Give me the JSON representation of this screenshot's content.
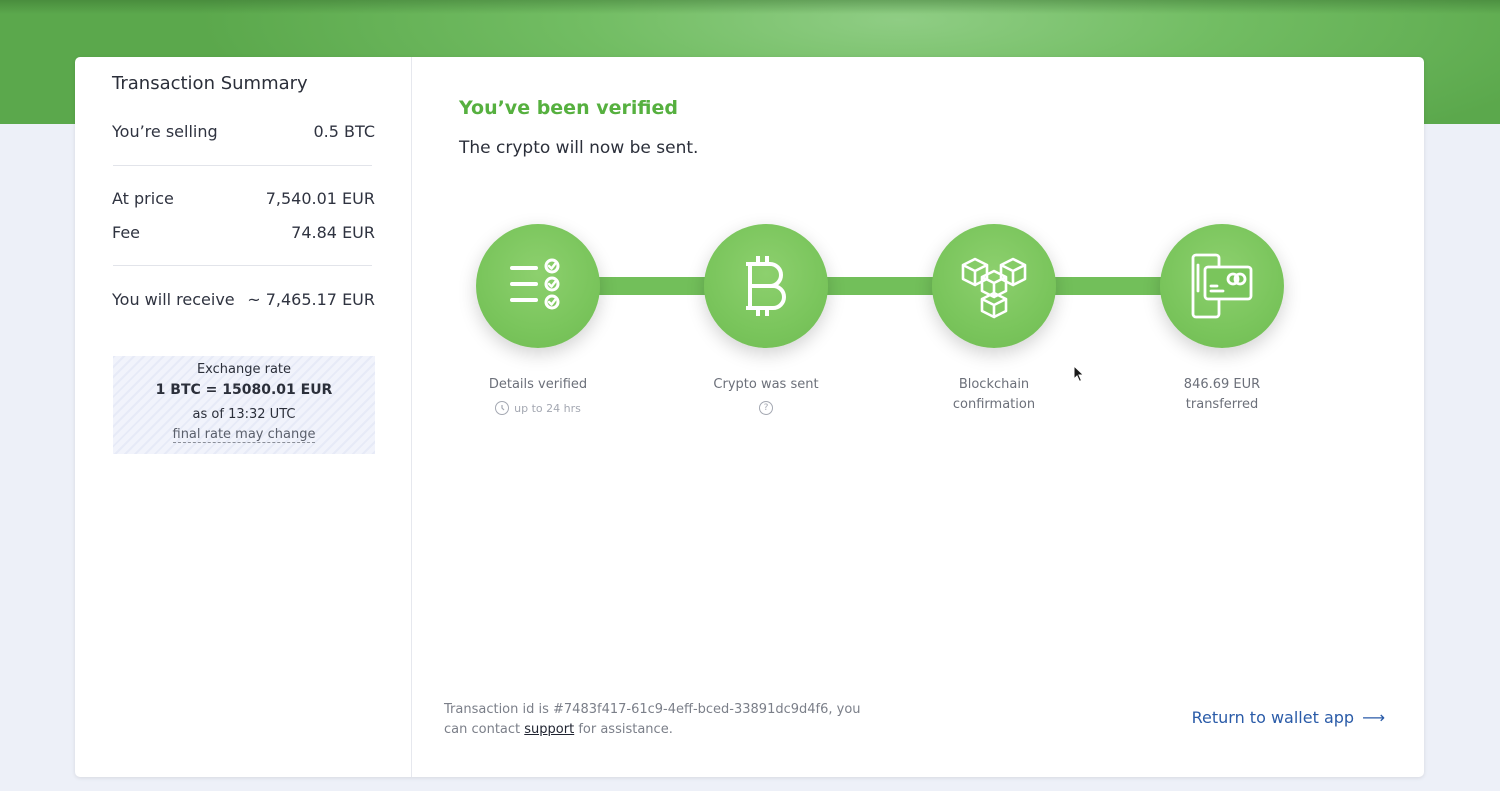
{
  "summary": {
    "title": "Transaction Summary",
    "selling_label": "You’re selling",
    "selling_value": "0.5 BTC",
    "price_label": "At price",
    "price_value": "7,540.01 EUR",
    "fee_label": "Fee",
    "fee_value": "74.84 EUR",
    "receive_label": "You will receive",
    "receive_value": "~ 7,465.17 EUR"
  },
  "exchange": {
    "label": "Exchange rate",
    "rate": "1 BTC = 15080.01 EUR",
    "as_of": "as of 13:32 UTC",
    "note": "final rate may change"
  },
  "status": {
    "title": "You’ve been verified",
    "subtitle": "The crypto will now be sent."
  },
  "steps": [
    {
      "icon": "checklist-icon",
      "label": "Details verified",
      "sub": "up to 24 hrs",
      "sub_icon": "clock-icon"
    },
    {
      "icon": "bitcoin-icon",
      "label": "Crypto was sent",
      "sub_icon": "help-icon",
      "sub_glyph": "?"
    },
    {
      "icon": "blocks-icon",
      "label_line1": "Blockchain",
      "label_line2": "confirmation"
    },
    {
      "icon": "card-terminal-icon",
      "label_line1": "846.69 EUR",
      "label_line2": "transferred"
    }
  ],
  "footer": {
    "text_before": "Transaction id is #7483f417-61c9-4eff-bced-33891dc9d4f6, you can contact ",
    "link_text": "support",
    "text_after": " for assistance.",
    "return_label": "Return to wallet app",
    "return_arrow": "⟶"
  },
  "colors": {
    "accent_green": "#56b03f",
    "step_green": "#7ac55c",
    "link_blue": "#2a5ba8",
    "background": "#edf0f8"
  }
}
